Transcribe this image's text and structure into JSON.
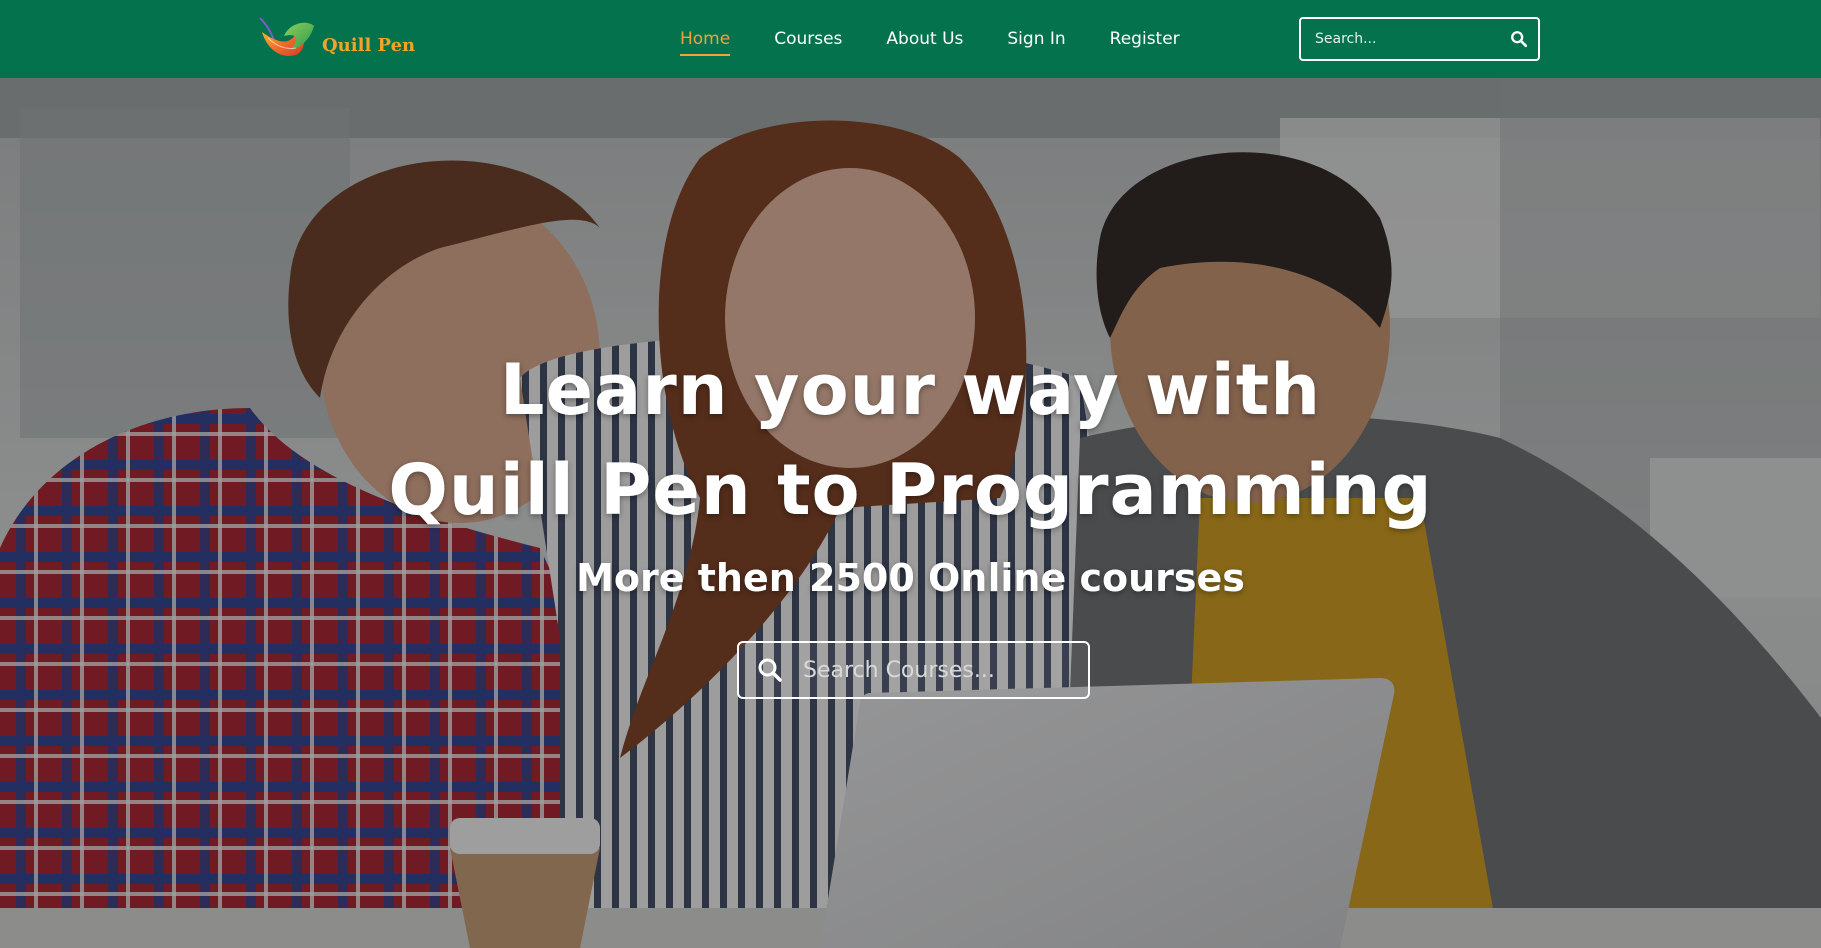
{
  "brand": {
    "name": "Quill Pen",
    "logo_icon": "quill-feather-icon",
    "name_color": "#f1a427"
  },
  "nav": {
    "background": "#04724d",
    "active_color": "#f2a13b",
    "items": [
      {
        "label": "Home",
        "active": true
      },
      {
        "label": "Courses",
        "active": false
      },
      {
        "label": "About Us",
        "active": false
      },
      {
        "label": "Sign In",
        "active": false
      },
      {
        "label": "Register",
        "active": false
      }
    ],
    "search": {
      "placeholder": "Search...",
      "icon": "search-icon"
    }
  },
  "hero": {
    "title_line1": "Learn your way with",
    "title_line2": "Quill Pen to Programming",
    "subtitle": "More then 2500 Online courses",
    "search": {
      "placeholder": "Search Courses...",
      "icon": "search-icon"
    },
    "background_image": "three students looking at a laptop"
  }
}
